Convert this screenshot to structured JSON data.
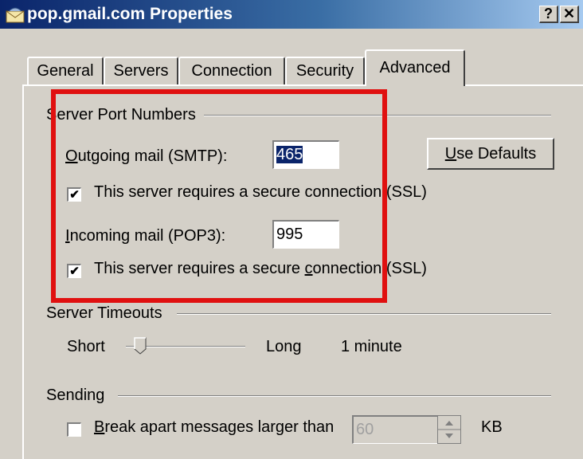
{
  "window": {
    "title": "pop.gmail.com Properties",
    "help_label": "?",
    "close_label": "✕"
  },
  "tabs": [
    {
      "label": "General"
    },
    {
      "label": "Servers"
    },
    {
      "label": "Connection"
    },
    {
      "label": "Security"
    },
    {
      "label": "Advanced"
    }
  ],
  "server_ports": {
    "group_label": "Server Port Numbers",
    "outgoing": {
      "label_first": "O",
      "label_rest": "utgoing mail (SMTP):",
      "value": "465"
    },
    "ssl1": {
      "checked": true,
      "label": "This server requires a secure connection (SSL)"
    },
    "incoming": {
      "label_first": "I",
      "label_rest": "ncoming mail (POP3):",
      "value": "995"
    },
    "ssl2": {
      "checked": true,
      "label_before": "This server requires a secure ",
      "label_accel": "c",
      "label_after": "onnection (SSL)"
    },
    "use_defaults": {
      "accel": "U",
      "rest": "se Defaults"
    }
  },
  "timeouts": {
    "group_label": "Server Timeouts",
    "short_label": "Short",
    "long_label": "Long",
    "value_label": "1 minute"
  },
  "sending": {
    "group_label": "Sending",
    "break_apart": {
      "checked": false,
      "accel": "B",
      "rest": "reak apart messages larger than",
      "value": "60",
      "unit": "KB"
    }
  },
  "colors": {
    "titlebar_start": "#0a246a",
    "titlebar_end": "#a6caf0",
    "highlight": "#e01010"
  }
}
